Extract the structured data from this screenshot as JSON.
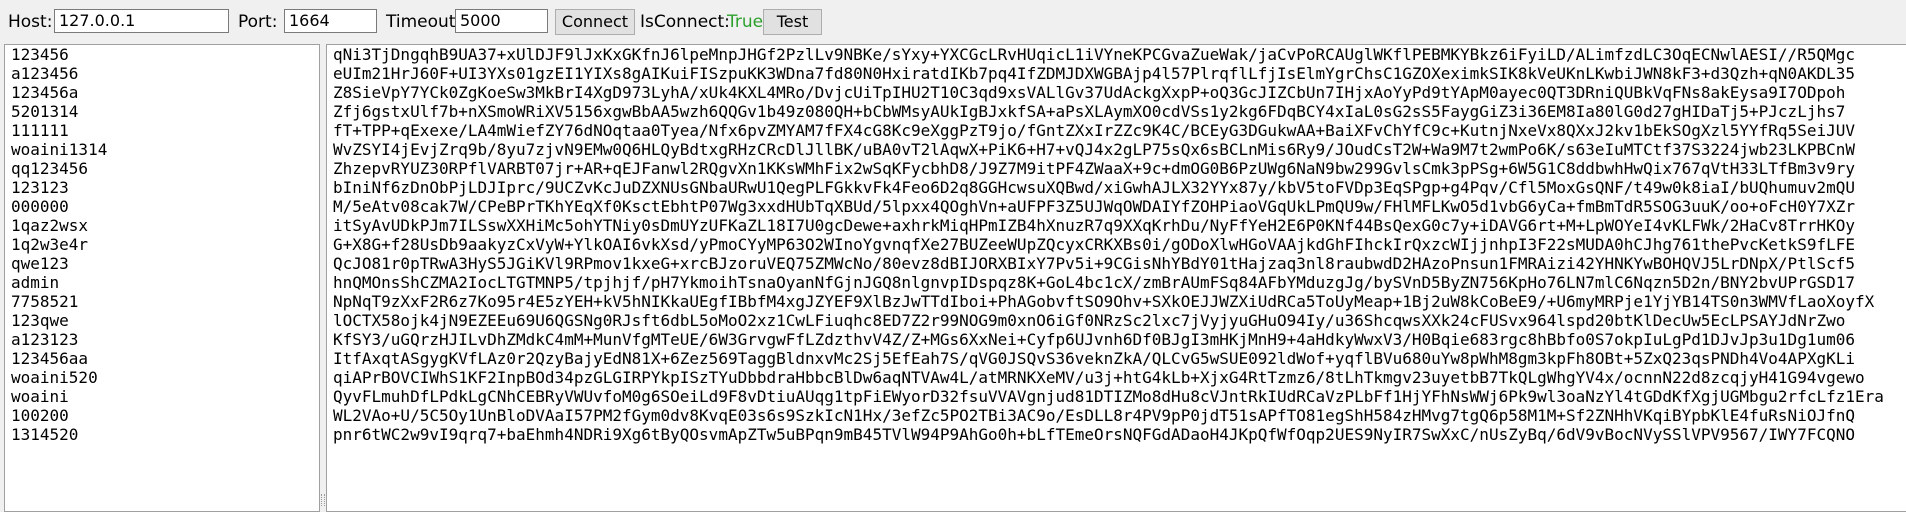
{
  "toolbar": {
    "host_label": "Host:",
    "host_value": "127.0.0.1",
    "port_label": "Port:",
    "port_value": "1664",
    "timeout_label": "Timeout:",
    "timeout_value": "5000",
    "connect_label": "Connect",
    "isconnect_label": "IsConnect:",
    "isconnect_value": "True",
    "test_label": "Test",
    "status_color": "#2ca02c"
  },
  "passwords": [
    "123456",
    "a123456",
    "123456a",
    "5201314",
    "111111",
    "woaini1314",
    "qq123456",
    "123123",
    "000000",
    "1qaz2wsx",
    "1q2w3e4r",
    "qwe123",
    "admin",
    "7758521",
    "123qwe",
    "a123123",
    "123456aa",
    "woaini520",
    "woaini",
    "100200",
    "1314520"
  ],
  "output_lines": [
    "qNi3TjDngqhB9UA37+xUlDJF9lJxKxGKfnJ6lpeMnpJHGf2PzlLv9NBKe/sYxy+YXCGcLRvHUqicL1iVYneKPCGvaZueWak/jaCvPoRCAUglWKflPEBMKYBkz6iFyiLD/ALimfzdLC3OqECNwlAESI//R5QMgc",
    "eUIm21HrJ60F+UI3YXs01gzEI1YIXs8gAIKuiFISzpuKK3WDna7fd80N0HxiratdIKb7pq4IfZDMJDXWGBAjp4l57PlrqflLfjIsElmYgrChsC1GZOXeximkSIK8kVeUKnLKwbiJWN8kF3+d3Qzh+qN0AKDL35",
    "Z8SieVpY7YCk0ZgKoeSw3MkBrI4XgD973LyhA/xUk4KXL4MRo/DvjcUiTpIHU2T10C3qd9xsVALlGv37UdAckgXxpP+oQ3GcJIZCbUn7IHjxAoYyPd9tYApM0ayec0QT3DRniQUBkVqFNs8akEysa9I7ODpoh",
    "Zfj6gstxUlf7b+nXSmoWRiXV5156xgwBbAA5wzh6QQGv1b49z080QH+bCbWMsyAUkIgBJxkfSA+aPsXLAymXO0cdVSs1y2kg6FDqBCY4xIaL0sG2sS5FaygGiZ3i36EM8Ia80lG0d27gHIDaTj5+PJczLjhs7",
    "fT+TPP+qExexe/LA4mWiefZY76dNOqtaa0Tyea/Nfx6pvZMYAM7fFX4cG8Kc9eXggPzT9jo/fGntZXxIrZZc9K4C/BCEyG3DGukwAA+BaiXFvChYfC9c+KutnjNxeVx8QXxJ2kv1bEkSOgXzl5YYfRq5SeiJUV",
    "WvZSYI4jEvjZrq9b/8yu7zjvN9EMw0Q6HLQyBdtxgRHzCRcDlJllBK/uBA0vT2lAqwX+PiK6+H7+vQJ4x2gLP75sQx6sBCLnMis6Ry9/JOudCsT2W+Wa9M7t2wmPo6K/s63eIuMTCtf37S3224jwb23LKPBCnW",
    "ZhzepvRYUZ30RPflVARBT07jr+AR+qEJFanwl2RQgvXn1KKsWMhFix2wSqKFycbhD8/J9Z7M9itPF4ZWaaX+9c+dmOG0B6PzUWg6NaN9bw299GvlsCmk3pPSg+6W5G1C8ddbwhHwQix767qVtH33LTfBm3v9ry",
    "bIniNf6zDnObPjLDJIprc/9UCZvKcJuDZXNUsGNbaURwU1QegPLFGkkvFk4Feo6D2q8GGHcwsuXQBwd/xiGwhAJLX32YYx87y/kbV5toFVDp3EqSPgp+g4Pqv/Cfl5MoxGsQNF/t49w0k8iaI/bUQhumuv2mQU",
    "M/5eAtv08cak7W/CPeBPrTKhYEqXf0KsctEbhtP07Wg3xxdHUbTqXBUd/5lpxx4QOghVn+aUFPF3Z5UJWqOWDAIYfZOHPiaoVGqUkLPmQU9w/FHlMFLKwO5d1vbG6yCa+fmBmTdR5SOG3uuK/oo+oFcH0Y7XZr",
    "itSyAvUDkPJm7ILSswXXHiMc5ohYTNiy0sDmUYzUFKaZL18I7U0gcDewe+axhrkMiqHPmIZB4hXnuzR7q9XXqKrhDu/NyFfYeH2E6P0KNf44BsQexG0c7y+iDAVG6rt+M+LpWOYeI4vKLFWk/2HaCv8TrrHKOy",
    "G+X8G+f28UsDb9aakyzCxVyW+YlkOAI6vkXsd/yPmoCYyMP63O2WInoYgvnqfXe27BUZeeWUpZQcyxCRKXBs0i/gODoXlwHGoVAAjkdGhFIhckIrQxzcWIjjnhpI3F22sMUDA0hCJhg761thePvcKetkS9fLFE",
    "QcJO81r0pTRwA3HyS5JGiKVl9RPmov1kxeG+xrcBJzoruVEQ75ZMWcNo/80evz8dBIJORXBIxY7Pv5i+9CGisNhYBdY01tHajzaq3nl8raubwdD2HAzoPnsun1FMRAizi42YHNKYwBOHQVJ5LrDNpX/PtlScf5",
    "hnQMOnsShCZMA2IocLTGTMNP5/tpjhjf/pH7YkmoihTsnaOyanNfGjnJGQ8nlgnvpIDspqz8K+GoL4bc1cX/zmBrAUmFSq84AFbYMduzgJg/bySVnD5ByZN756KpHo76LN7mlC6Nqzn5D2n/BNY2bvUPrGSD17",
    "NpNqT9zXxF2R6z7Ko95r4E5zYEH+kV5hNIKkaUEgfIBbfM4xgJZYEF9XlBzJwTTdIboi+PhAGobvftSO9Ohv+SXkOEJJWZXiUdRCa5ToUyMeap+1Bj2uW8kCoBeE9/+U6myMRPje1YjYB14TS0n3WMVfLaoXoyfX",
    "lOCTX58ojk4jN9EZEEu69U6QGSNg0RJsft6dbL5oMoO2xz1CwLFiuqhc8ED7Z2r99NOG9m0xnO6iGf0NRzSc2lxc7jVyjyuGHuO94Iy/u36ShcqwsXXk24cFUSvx964lspd20btKlDecUw5EcLPSAYJdNrZwo",
    "KfSY3/uGQrzHJILvDhZMdkC4mM+MunVfgMTeUE/6W3GrvgwFfLZdzthvV4Z/Z+MGs6XxNei+Cyfp6UJvnh6Df0BJgI3mHKjMnH9+4aHdkyWwxV3/H0Bqie683rgc8hBbfo0S7okpIuLgPd1DJvJp3u1Dg1um06",
    "ItfAxqtASgygKVfLAz0r2QzyBajyEdN81X+6Zez569TaggBldnxvMc2Sj5EfEah7S/qVG0JSQvS36veknZkA/QLCvG5wSUE092ldWof+yqflBVu680uYw8pWhM8gm3kpFh8OBt+5ZxQ23qsPNDh4Vo4APXgKLi",
    "qiAPrBOVCIWhS1KF2InpBOd34pzGLGIRPYkpISzTYuDbbdraHbbcBlDw6aqNTVAw4L/atMRNKXeMV/u3j+htG4kLb+XjxG4RtTzmz6/8tLhTkmgv23uyetbB7TkQLgWhgYV4x/ocnnN22d8zcqjyH41G94vgewo",
    "QyvFLmuhDfLPdkLgCNhCEBRyVWUvfoM0g6SOeiLd9F8vDtiuAUqg1tpFiEWyorD32fsuVVAVgnjud81DTIZMo8dHu8cVJntRkIUdRCaVzPLbFf1HjYFhNsWWj6Pk9wl3oaNzYl4tGDdKfXgjUGMbgu2rfcLfz1Era",
    "WL2VAo+U/5C5Oy1UnBloDVAaI57PM2fGym0dv8KvqE03s6s9SzkIcN1Hx/3efZc5PO2TBi3AC9o/EsDLL8r4PV9pP0jdT51sAPfTO81egShH584zHMvg7tgQ6p58M1M+Sf2ZNHhVKqiBYpbKlE4fuRsNiOJfnQ",
    "pnr6tWC2w9vI9qrq7+baEhmh4NDRi9Xg6tByQOsvmApZTw5uBPqn9mB45TVlW94P9AhGo0h+bLfTEmeOrsNQFGdADaoH4JKpQfWfOqp2UES9NyIR7SwXxC/nUsZyBq/6dV9vBocNVySSlVPV9567/IWY7FCQNO"
  ]
}
